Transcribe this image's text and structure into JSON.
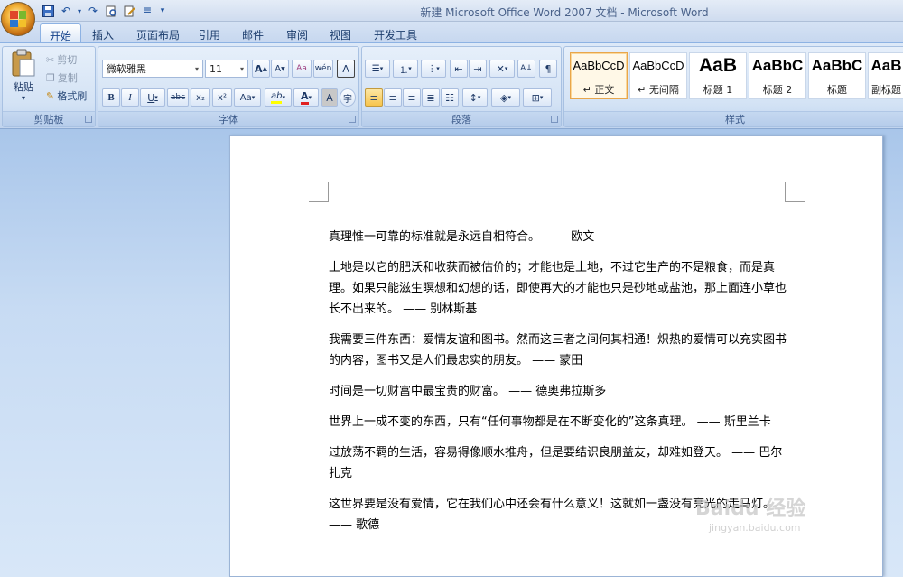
{
  "window": {
    "title": "新建 Microsoft Office Word 2007 文档 - Microsoft Word"
  },
  "quick_access": {
    "more": "▾"
  },
  "tabs": [
    {
      "label": "开始"
    },
    {
      "label": "插入"
    },
    {
      "label": "页面布局"
    },
    {
      "label": "引用"
    },
    {
      "label": "邮件"
    },
    {
      "label": "审阅"
    },
    {
      "label": "视图"
    },
    {
      "label": "开发工具"
    }
  ],
  "clipboard": {
    "paste": "粘贴",
    "cut": "剪切",
    "copy": "复制",
    "format_painter": "格式刷",
    "group": "剪贴板"
  },
  "font": {
    "name": "微软雅黑",
    "size": "11",
    "group": "字体",
    "grow": "A",
    "shrink": "A",
    "clear": "Aa",
    "phonetic": "wén",
    "border_char": "A",
    "bold": "B",
    "italic": "I",
    "underline": "U",
    "strike": "abc",
    "subscript": "x₂",
    "superscript": "x²",
    "case": "Aa",
    "highlight": "ab",
    "color": "A",
    "shade": "A",
    "enclose": "字"
  },
  "paragraph": {
    "group": "段落"
  },
  "styles": {
    "group": "样式",
    "items": [
      {
        "preview": "AaBbCcD",
        "name": "↵ 正文"
      },
      {
        "preview": "AaBbCcD",
        "name": "↵ 无间隔"
      },
      {
        "preview": "AaB",
        "name": "标题 1"
      },
      {
        "preview": "AaBbC",
        "name": "标题 2"
      },
      {
        "preview": "AaBbC",
        "name": "标题"
      },
      {
        "preview": "AaB",
        "name": "副标题"
      }
    ]
  },
  "document": {
    "paragraphs": [
      "真理惟一可靠的标准就是永远自相符合。 —— 欧文",
      "土地是以它的肥沃和收获而被估价的；才能也是土地，不过它生产的不是粮食，而是真理。如果只能滋生瞑想和幻想的话，即使再大的才能也只是砂地或盐池，那上面连小草也长不出来的。 —— 别林斯基",
      "我需要三件东西：爱情友谊和图书。然而这三者之间何其相通！炽热的爱情可以充实图书的内容，图书又是人们最忠实的朋友。 —— 蒙田",
      "时间是一切财富中最宝贵的财富。 —— 德奥弗拉斯多",
      "世界上一成不变的东西，只有“任何事物都是在不断变化的”这条真理。 —— 斯里兰卡",
      "过放荡不羁的生活，容易得像顺水推舟，但是要结识良朋益友，却难如登天。 —— 巴尔扎克",
      "这世界要是没有爱情，它在我们心中还会有什么意义！这就如一盏没有亮光的走马灯。 —— 歌德"
    ]
  },
  "watermark": {
    "main": "Baidu 经验",
    "sub": "jingyan.baidu.com"
  }
}
